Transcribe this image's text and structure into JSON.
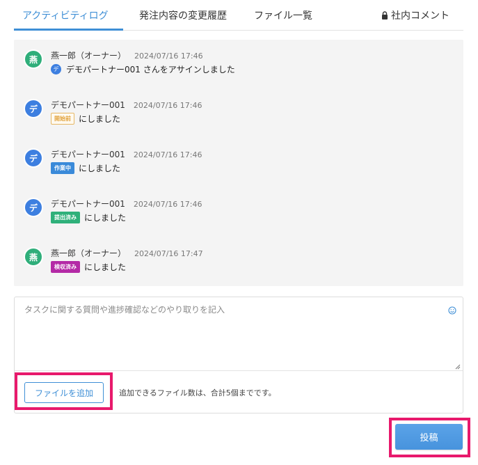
{
  "tabs": [
    {
      "label": "アクティビティログ",
      "active": true
    },
    {
      "label": "発注内容の変更履歴",
      "active": false
    },
    {
      "label": "ファイル一覧",
      "active": false
    },
    {
      "label": "社内コメント",
      "active": false,
      "icon": "lock-icon"
    }
  ],
  "log": [
    {
      "avatar_char": "燕",
      "avatar_color": "#2fae7a",
      "name": "燕一郎（オーナー）",
      "timestamp": "2024/07/16 17:46",
      "mini_avatar": "デ",
      "message": "デモパートナー001 さんをアサインしました"
    },
    {
      "avatar_char": "デ",
      "avatar_color": "#3d7fe0",
      "name": "デモパートナー001",
      "timestamp": "2024/07/16 17:46",
      "badge": "開始前",
      "message": "にしました"
    },
    {
      "avatar_char": "デ",
      "avatar_color": "#3d7fe0",
      "name": "デモパートナー001",
      "timestamp": "2024/07/16 17:46",
      "badge": "作業中",
      "message": "にしました"
    },
    {
      "avatar_char": "デ",
      "avatar_color": "#3d7fe0",
      "name": "デモパートナー001",
      "timestamp": "2024/07/16 17:46",
      "badge": "提出済み",
      "message": "にしました"
    },
    {
      "avatar_char": "燕",
      "avatar_color": "#2fae7a",
      "name": "燕一郎（オーナー）",
      "timestamp": "2024/07/16 17:47",
      "badge": "検収済み",
      "message": "にしました"
    }
  ],
  "comment": {
    "placeholder": "タスクに関する質問や進捗確認などのやり取りを記入",
    "add_file_label": "ファイルを追加",
    "file_note": "追加できるファイル数は、合計5個までです。"
  },
  "post_label": "投稿",
  "colors": {
    "accent": "#3f8fd6",
    "highlight": "#e8196c"
  }
}
